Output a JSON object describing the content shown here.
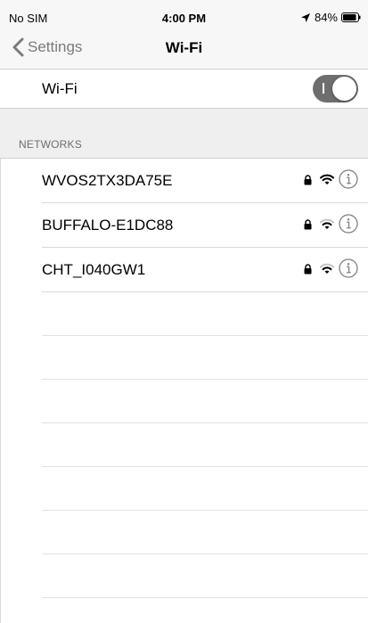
{
  "status_bar": {
    "carrier": "No SIM",
    "time": "4:00 PM",
    "battery": "84%",
    "icons": [
      "location-arrow-icon",
      "battery-icon"
    ]
  },
  "nav": {
    "back_label": "Settings",
    "title": "Wi-Fi"
  },
  "wifi_toggle": {
    "label": "Wi-Fi",
    "state": "off"
  },
  "networks_section": {
    "header": "NETWORKS",
    "items": [
      {
        "name": "WVOS2TX3DA75E",
        "secured": true,
        "signal": "strong",
        "icons": [
          "lock-icon",
          "wifi-signal-icon",
          "info-icon"
        ]
      },
      {
        "name": "BUFFALO-E1DC88",
        "secured": true,
        "signal": "medium",
        "icons": [
          "lock-icon",
          "wifi-signal-icon",
          "info-icon"
        ]
      },
      {
        "name": "CHT_I040GW1",
        "secured": true,
        "signal": "medium",
        "icons": [
          "lock-icon",
          "wifi-signal-icon",
          "info-icon"
        ]
      }
    ]
  },
  "colors": {
    "bar_background": "#f7f7f7",
    "section_background": "#efefef",
    "toggle_background": "#6e6e6e",
    "icon_gray": "#7a7a7a"
  }
}
